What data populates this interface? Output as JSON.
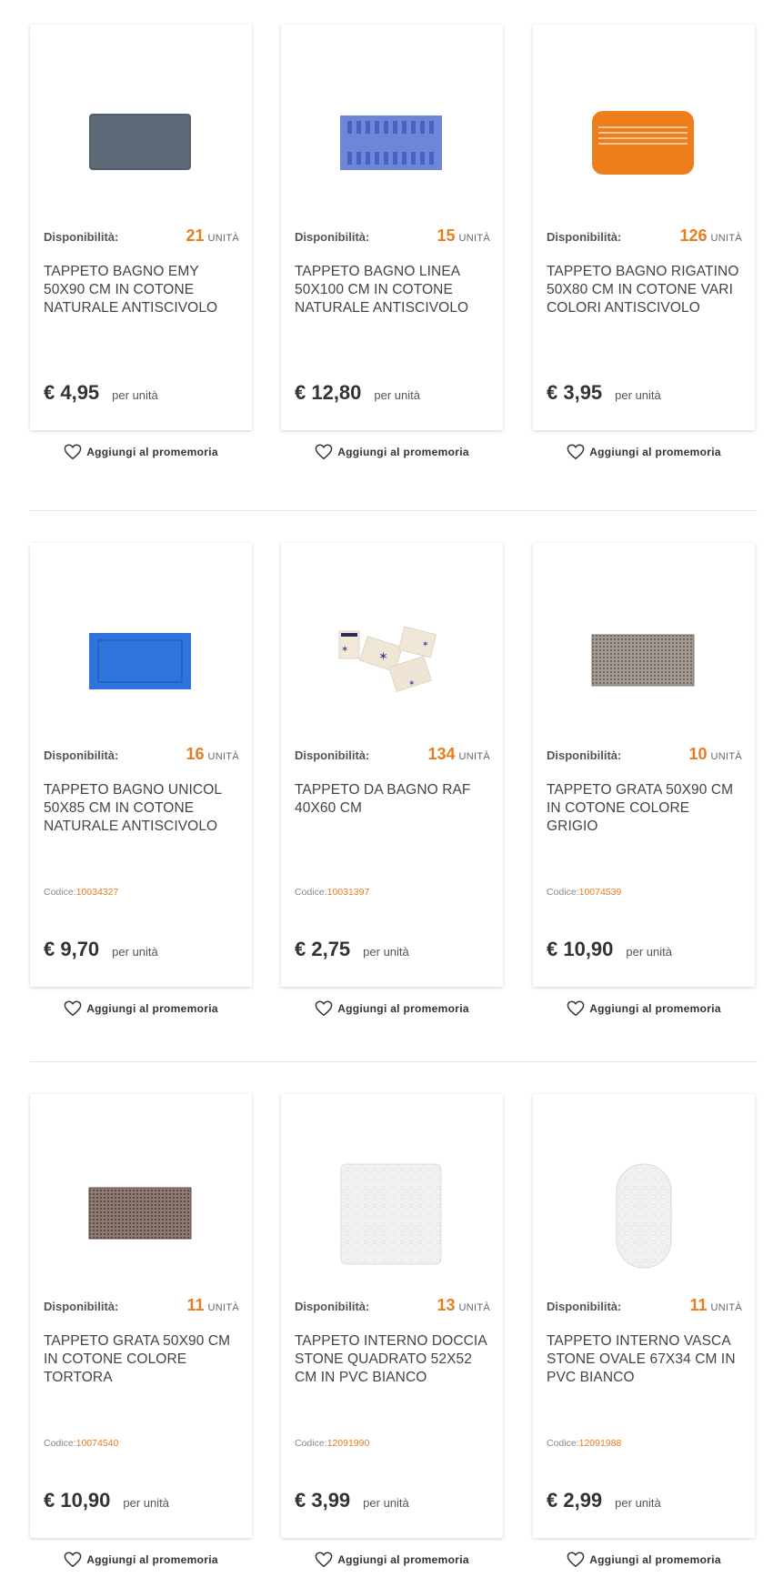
{
  "labels": {
    "availability": "Disponibilità:",
    "unit": "UNITÀ",
    "per_unit": "per unità",
    "code_label": "Codice:",
    "reminder": "Aggiungi al promemoria"
  },
  "icons": {
    "reminder": "heart-outline-icon"
  },
  "colors": {
    "accent": "#e67d1f",
    "text": "#333333"
  },
  "products": [
    {
      "qty": "21",
      "title": "TAPPETO BAGNO EMY 50X90 CM IN COTONE NATURALE ANTISCIVOLO",
      "code": "",
      "price": "€ 4,95",
      "image": "grey-bath-mat"
    },
    {
      "qty": "15",
      "title": "TAPPETO BAGNO LINEA 50X100 CM IN COTONE NATURALE ANTISCIVOLO",
      "code": "",
      "price": "€ 12,80",
      "image": "blue-ribbed-bath-mat"
    },
    {
      "qty": "126",
      "title": "TAPPETO BAGNO RIGATINO 50X80 CM IN COTONE VARI COLORI ANTISCIVOLO",
      "code": "",
      "price": "€ 3,95",
      "image": "orange-striped-bath-mat"
    },
    {
      "qty": "16",
      "title": "TAPPETO BAGNO UNICOL 50X85 CM IN COTONE NATURALE ANTISCIVOLO",
      "code": "10034327",
      "price": "€ 9,70",
      "image": "blue-bath-mat"
    },
    {
      "qty": "134",
      "title": "TAPPETO DA BAGNO RAF 40X60 CM",
      "code": "10031397",
      "price": "€ 2,75",
      "image": "starfish-mat-set"
    },
    {
      "qty": "10",
      "title": "TAPPETO GRATA 50X90 CM IN COTONE COLORE GRIGIO",
      "code": "10074539",
      "price": "€ 10,90",
      "image": "grey-grid-mat"
    },
    {
      "qty": "11",
      "title": "TAPPETO GRATA 50X90 CM IN COTONE COLORE TORTORA",
      "code": "10074540",
      "price": "€ 10,90",
      "image": "taupe-grid-mat"
    },
    {
      "qty": "13",
      "title": "TAPPETO INTERNO DOCCIA STONE QUADRATO 52X52 CM IN PVC BIANCO",
      "code": "12091990",
      "price": "€ 3,99",
      "image": "white-square-shower-mat"
    },
    {
      "qty": "11",
      "title": "TAPPETO INTERNO VASCA STONE OVALE 67X34 CM IN PVC BIANCO",
      "code": "12091988",
      "price": "€ 2,99",
      "image": "white-oval-tub-mat"
    }
  ]
}
